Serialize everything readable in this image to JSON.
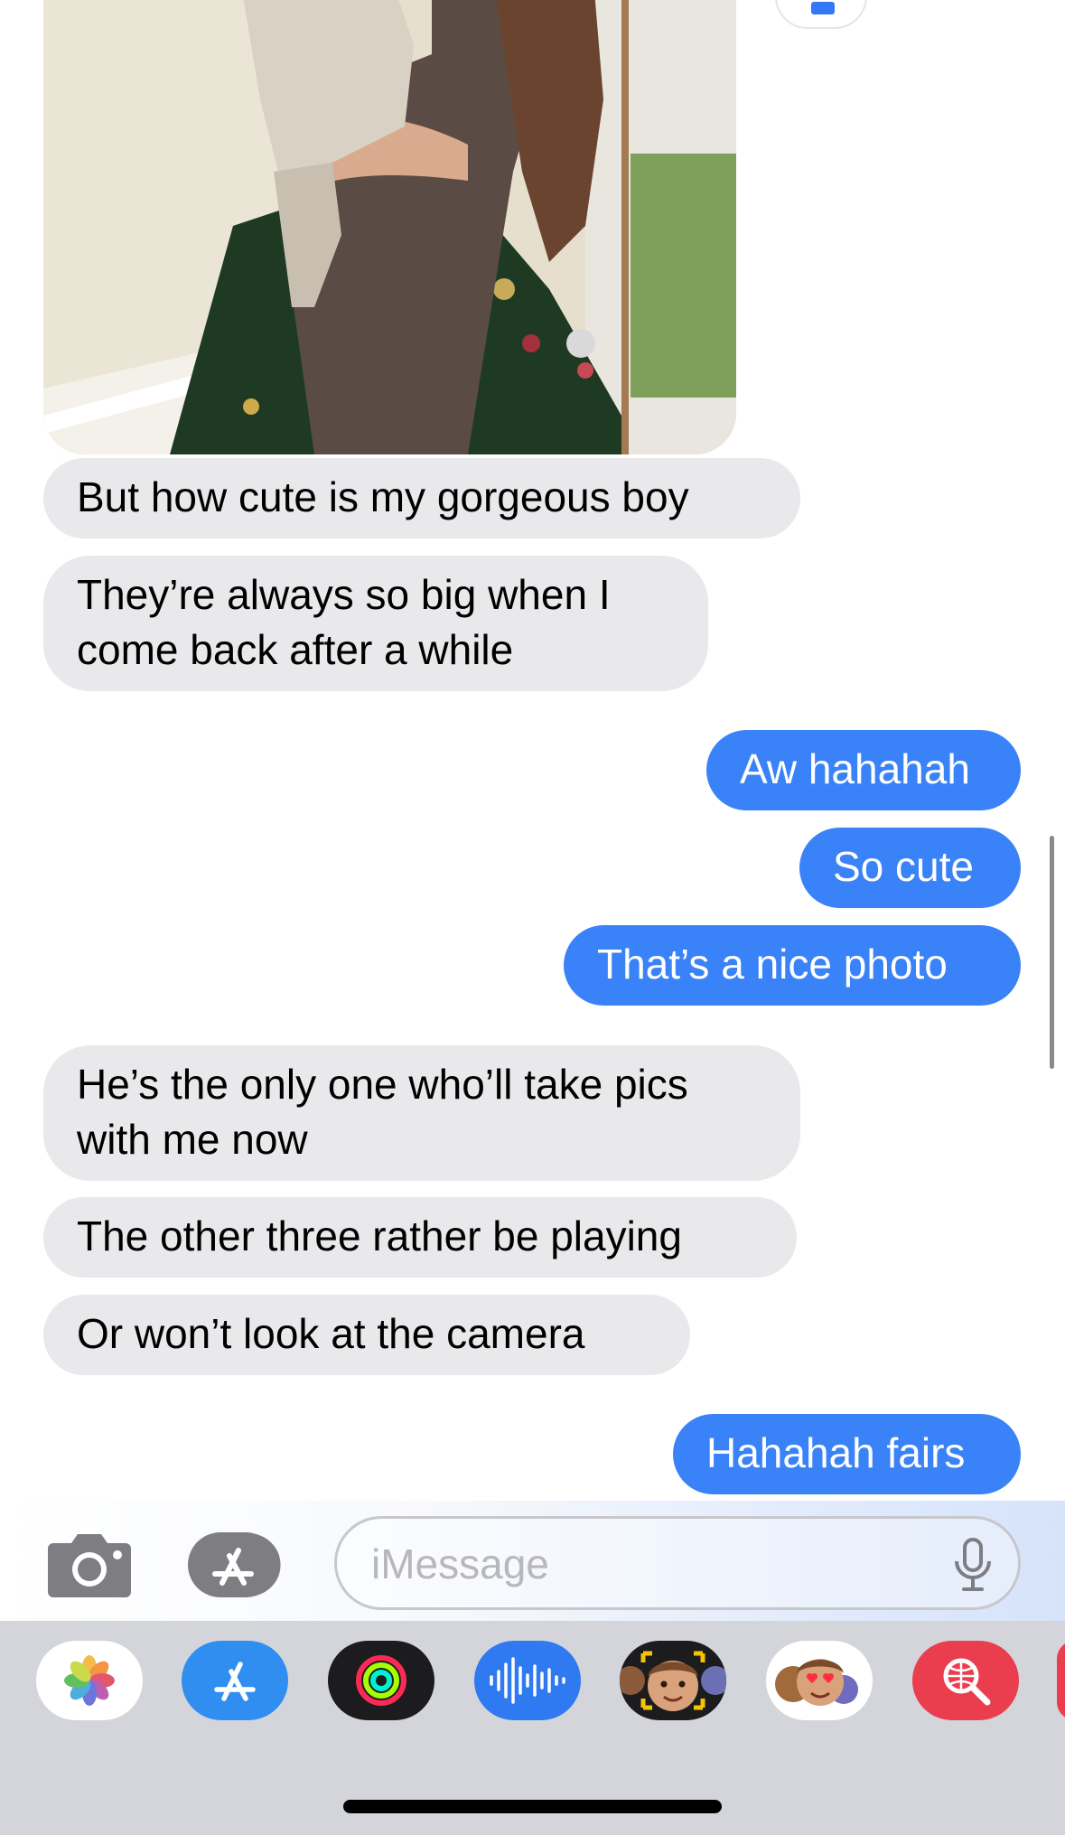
{
  "conversation": {
    "incoming_1": [
      "But how cute is my gorgeous boy",
      "They’re always so big when I",
      "come back after a while"
    ],
    "outgoing_1": [
      "Aw hahahah",
      "So cute",
      "That’s a nice photo"
    ],
    "incoming_2": [
      "He’s the only one who’ll take pics",
      "with me now",
      "The other three rather be playing",
      "Or won’t look at the camera"
    ],
    "outgoing_2": [
      "Hahahah fairs"
    ]
  },
  "input": {
    "placeholder": "iMessage"
  },
  "colors": {
    "outgoing_bubble": "#3a82f7",
    "incoming_bubble": "#e9e9eb",
    "drawer_background": "#d3d5db"
  },
  "icons": {
    "camera": "camera-icon",
    "apps": "app-store-icon",
    "mic": "microphone-icon",
    "drawer": [
      "photos-icon",
      "app-store-icon",
      "activity-icon",
      "audio-waveform-icon",
      "memoji-icon",
      "memoji-stickers-icon",
      "web-search-icon"
    ]
  }
}
